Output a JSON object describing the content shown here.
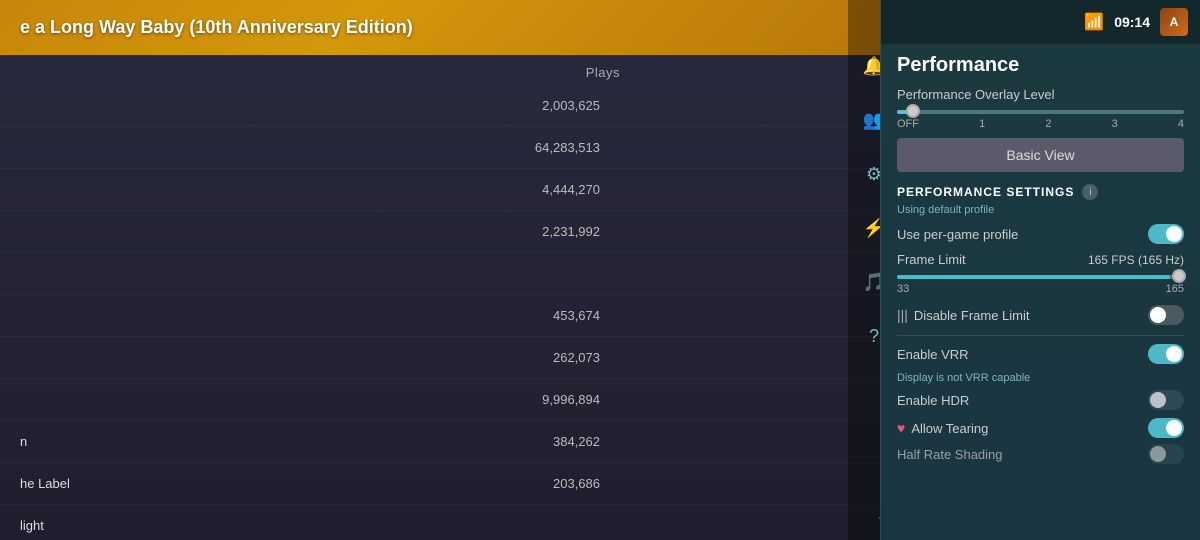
{
  "app": {
    "title": "e a Long Way Baby (10th Anniversary Edition)"
  },
  "topbar": {
    "time": "09:14",
    "wifi_icon": "📶",
    "avatar_initials": "A"
  },
  "music_table": {
    "plays_header": "Plays",
    "tracks": [
      {
        "name": "",
        "plays": "2,003,625"
      },
      {
        "name": "",
        "plays": "64,283,513"
      },
      {
        "name": "",
        "plays": "4,444,270"
      },
      {
        "name": "",
        "plays": "2,231,992"
      },
      {
        "name": "",
        "plays": ""
      },
      {
        "name": "",
        "plays": "453,674"
      },
      {
        "name": "",
        "plays": "262,073"
      },
      {
        "name": "",
        "plays": "9,996,894"
      },
      {
        "name": "n",
        "plays": "384,262"
      },
      {
        "name": "he Label",
        "plays": "203,686"
      },
      {
        "name": "light",
        "plays": ""
      }
    ]
  },
  "performance": {
    "title": "Performance",
    "overlay_level_label": "Performance Overlay Level",
    "overlay_levels": [
      "OFF",
      "1",
      "2",
      "3",
      "4"
    ],
    "overlay_current": 0,
    "basic_view_btn": "Basic View",
    "settings_title": "PERFORMANCE SETTINGS",
    "using_default": "Using default profile",
    "use_per_game_label": "Use per-game profile",
    "use_per_game_on": true,
    "frame_limit_label": "Frame Limit",
    "frame_limit_value": "165 FPS (165 Hz)",
    "frame_limit_min": "33",
    "frame_limit_max": "165",
    "frame_limit_current": 165,
    "disable_frame_limit_label": "Disable Frame Limit",
    "disable_frame_limit_on": false,
    "enable_vrr_label": "Enable VRR",
    "enable_vrr_on": true,
    "vrr_sublabel": "Display is not VRR capable",
    "enable_hdr_label": "Enable HDR",
    "enable_hdr_on": false,
    "allow_tearing_label": "Allow Tearing",
    "allow_tearing_on": true,
    "half_rate_label": "Half Rate Shading",
    "half_rate_on": false
  },
  "nav_icons": {
    "bell": "🔔",
    "people": "👥",
    "gear": "⚙",
    "lightning": "⚡",
    "music": "🎵",
    "question": "?",
    "download": "⬇"
  }
}
